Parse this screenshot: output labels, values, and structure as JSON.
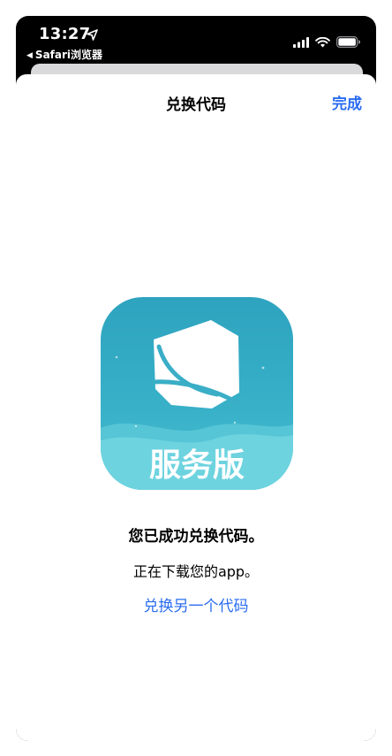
{
  "status_bar": {
    "time": "13:27",
    "back_app_label": "Safari浏览器"
  },
  "nav": {
    "title": "兑换代码",
    "done_label": "完成"
  },
  "app_icon": {
    "label": "服务版",
    "colors": {
      "top": "#2fa7c2",
      "bottom": "#6bd3df",
      "wave": "#5ccad9",
      "mark": "#ffffff"
    }
  },
  "main": {
    "success_message": "您已成功兑换代码。",
    "downloading_message": "正在下载您的app。",
    "redeem_another_link": "兑换另一个代码"
  },
  "colors": {
    "link": "#2a6cf0",
    "status_bar_bg": "#000000",
    "sheet_bg": "#ffffff"
  }
}
